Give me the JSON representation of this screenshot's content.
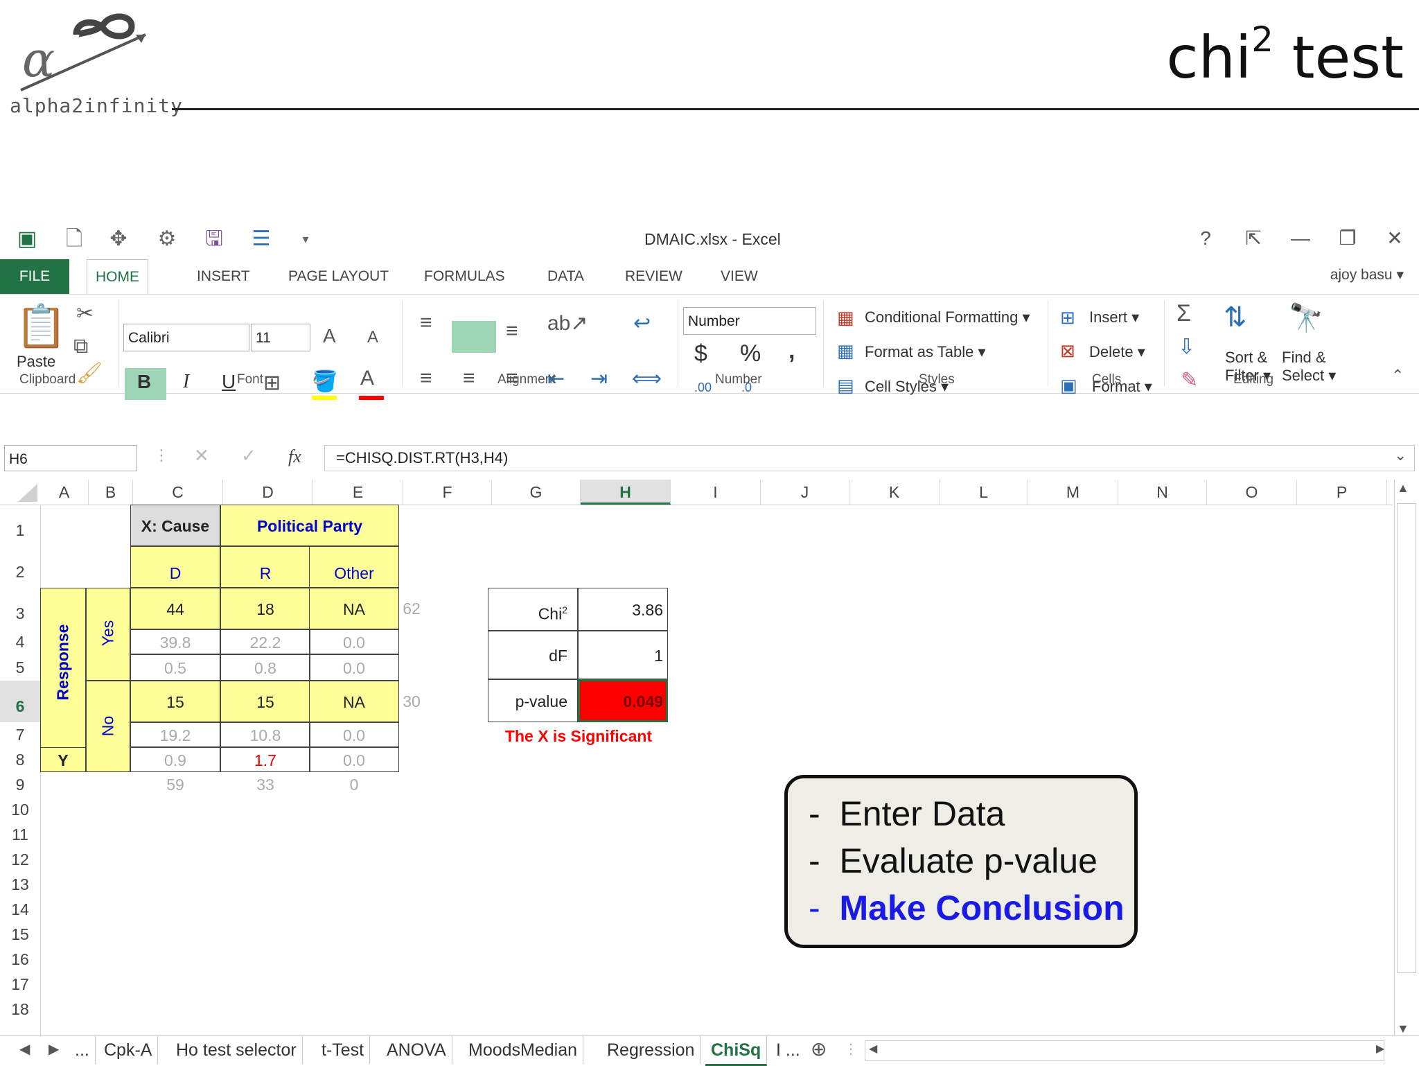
{
  "slide": {
    "logo_text": "alpha2infinity",
    "title_main": "chi",
    "title_sup": "2",
    "title_rest": " test"
  },
  "window": {
    "title": "DMAIC.xlsx - Excel",
    "help": "?",
    "user": "ajoy basu"
  },
  "tabs": [
    "FILE",
    "HOME",
    "INSERT",
    "PAGE LAYOUT",
    "FORMULAS",
    "DATA",
    "REVIEW",
    "VIEW"
  ],
  "ribbon": {
    "clipboard": {
      "paste": "Paste",
      "label": "Clipboard"
    },
    "font": {
      "name": "Calibri",
      "size": "11",
      "label": "Font",
      "bold": "B",
      "italic": "I",
      "underline": "U"
    },
    "alignment": {
      "label": "Alignment"
    },
    "number": {
      "format": "Number",
      "dollar": "$",
      "percent": "%",
      "comma": ",",
      "label": "Number",
      "inc": ".00",
      "dec": ".0"
    },
    "styles": {
      "conditional": "Conditional Formatting",
      "format_table": "Format as Table",
      "cell_styles": "Cell Styles",
      "label": "Styles"
    },
    "cells": {
      "insert": "Insert",
      "delete": "Delete",
      "format": "Format",
      "label": "Cells"
    },
    "editing": {
      "sort": "Sort &",
      "sort2": "Filter",
      "find": "Find &",
      "find2": "Select",
      "label": "Editing"
    }
  },
  "formula_bar": {
    "name_box": "H6",
    "fx": "fx",
    "formula": "=CHISQ.DIST.RT(H3,H4)"
  },
  "columns": [
    "A",
    "B",
    "C",
    "D",
    "E",
    "F",
    "G",
    "H",
    "I",
    "J",
    "K",
    "L",
    "M",
    "N",
    "O",
    "P"
  ],
  "rows": [
    "1",
    "2",
    "3",
    "4",
    "5",
    "6",
    "7",
    "8",
    "9",
    "10",
    "11",
    "12",
    "13",
    "14",
    "15",
    "16",
    "17",
    "18"
  ],
  "table": {
    "cause": "X: Cause",
    "party": "Political Party",
    "response": "Response",
    "yes": "Yes",
    "no": "No",
    "y": "Y",
    "headers": [
      "D",
      "R",
      "Other"
    ],
    "yes_obs": [
      "44",
      "18",
      "NA"
    ],
    "yes_exp": [
      "39.8",
      "22.2",
      "0.0"
    ],
    "yes_chi": [
      "0.5",
      "0.8",
      "0.0"
    ],
    "no_obs": [
      "15",
      "15",
      "NA"
    ],
    "no_exp": [
      "19.2",
      "10.8",
      "0.0"
    ],
    "no_chi": [
      "0.9",
      "1.7",
      "0.0"
    ],
    "col_totals": [
      "59",
      "33",
      "0"
    ],
    "row_total_yes": "62",
    "row_total_no": "30"
  },
  "stats": {
    "chi_label": "Chi",
    "chi_sup": "2",
    "chi_value": "3.86",
    "df_label": "dF",
    "df_value": "1",
    "p_label": "p-value",
    "p_value": "0.049",
    "conclusion": "The X is Significant"
  },
  "callout": {
    "items": [
      "Enter Data",
      "Evaluate p-value",
      "Make Conclusion"
    ]
  },
  "sheets": [
    "...",
    "Cpk-A",
    "Ho test selector",
    "t-Test",
    "ANOVA",
    "MoodsMedian",
    "Regression",
    "ChiSq",
    "I ..."
  ],
  "colors": {
    "excel_green": "#217346",
    "yellow": "#ffff99",
    "red": "#ff0000",
    "blue": "#0000cc"
  }
}
